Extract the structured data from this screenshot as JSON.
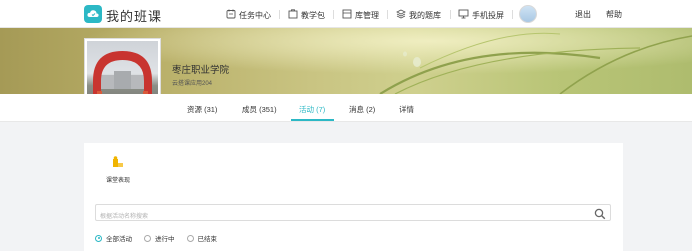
{
  "app": {
    "title": "我的班课",
    "accent": "#2cb8c5"
  },
  "nav": {
    "items": [
      {
        "label": "任务中心",
        "icon": "task-icon"
      },
      {
        "label": "教学包",
        "icon": "package-icon"
      },
      {
        "label": "库管理",
        "icon": "library-icon"
      },
      {
        "label": "我的题库",
        "icon": "question-bank-icon"
      },
      {
        "label": "手机投屏",
        "icon": "screen-cast-icon"
      }
    ],
    "logout": "退出",
    "help": "帮助"
  },
  "class": {
    "school": "枣庄职业学院",
    "name": "云搭课应用204"
  },
  "tabs": [
    {
      "label": "资源 (31)",
      "active": false
    },
    {
      "label": "成员 (351)",
      "active": false
    },
    {
      "label": "活动 (7)",
      "active": true
    },
    {
      "label": "消息 (2)",
      "active": false
    },
    {
      "label": "详情",
      "active": false
    }
  ],
  "activity": {
    "tool_label": "课堂表现",
    "search_placeholder": "根据活动名称搜索",
    "filters": [
      {
        "label": "全部活动",
        "selected": true
      },
      {
        "label": "进行中",
        "selected": false
      },
      {
        "label": "已结束",
        "selected": false
      }
    ]
  }
}
